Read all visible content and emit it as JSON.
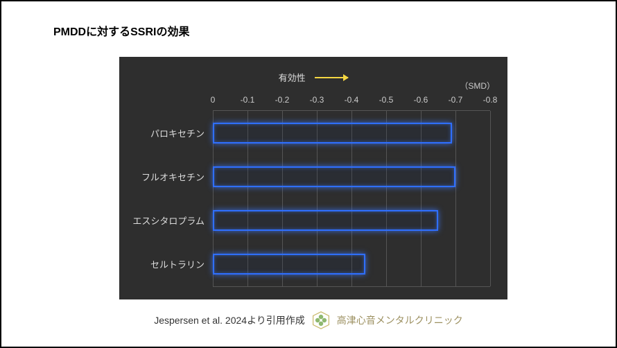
{
  "title": "PMDDに対するSSRIの効果",
  "chart_data": {
    "type": "bar",
    "orientation": "horizontal",
    "title": "有効性",
    "unit_label": "（SMD）",
    "xlabel": "",
    "ylabel": "",
    "xlim": [
      0,
      -0.8
    ],
    "ticks": [
      "0",
      "-0.1",
      "-0.2",
      "-0.3",
      "-0.4",
      "-0.5",
      "-0.6",
      "-0.7",
      "-0.8"
    ],
    "categories": [
      "パロキセチン",
      "フルオキセチン",
      "エスシタロプラム",
      "セルトラリン"
    ],
    "values": [
      -0.69,
      -0.7,
      -0.65,
      -0.44
    ]
  },
  "credit": {
    "source": "Jespersen et al. 2024より引用作成",
    "clinic": "高津心音メンタルクリニック"
  }
}
